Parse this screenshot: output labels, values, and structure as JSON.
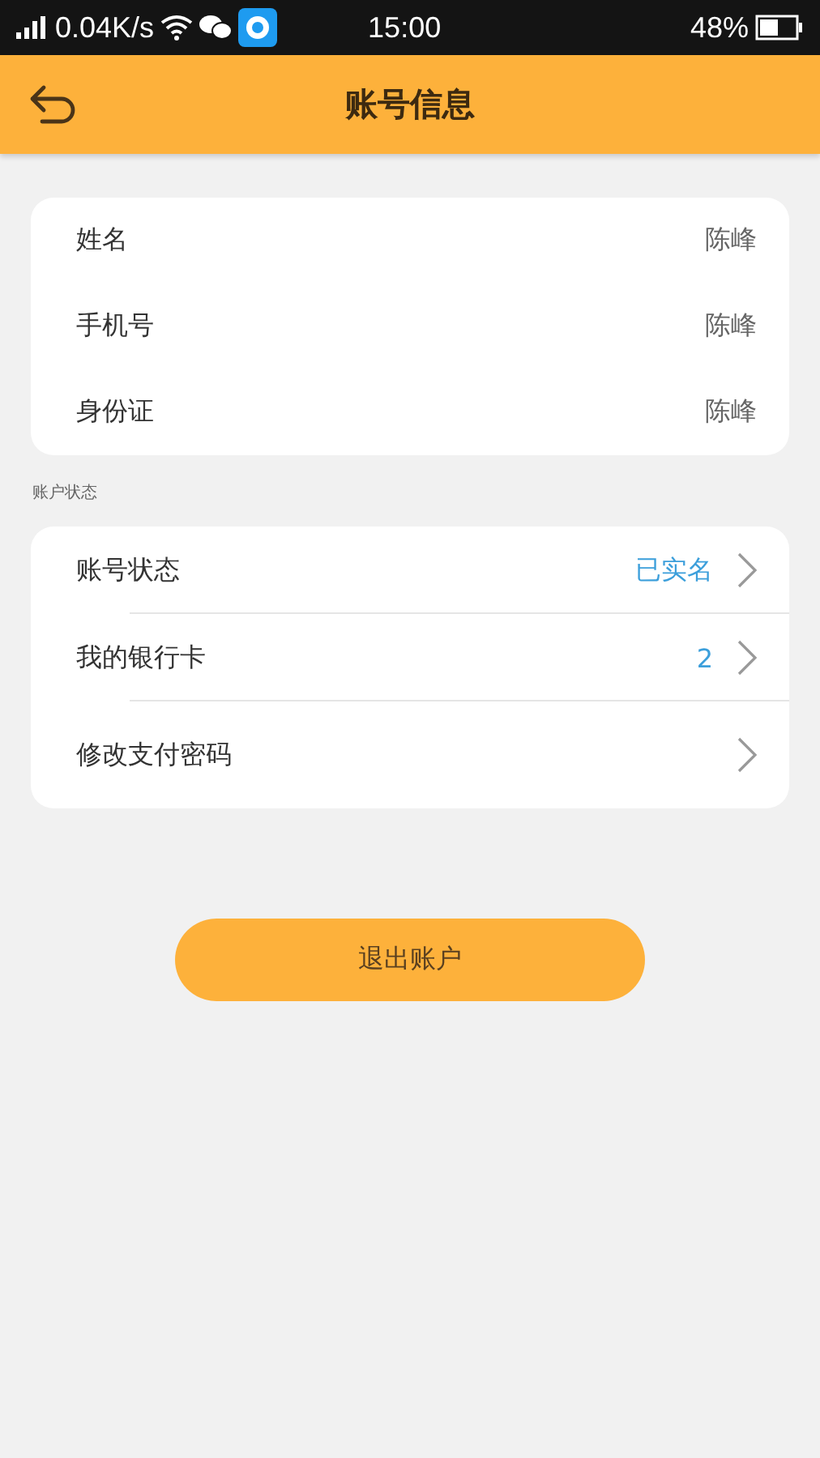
{
  "status_bar": {
    "speed": "0.04K/s",
    "time": "15:00",
    "battery": "48%"
  },
  "header": {
    "title": "账号信息"
  },
  "info_rows": [
    {
      "label": "姓名",
      "value": "陈峰"
    },
    {
      "label": "手机号",
      "value": "陈峰"
    },
    {
      "label": "身份证",
      "value": "陈峰"
    }
  ],
  "section_title": "账户状态",
  "status_rows": [
    {
      "label": "账号状态",
      "value": "已实名"
    },
    {
      "label": "我的银行卡",
      "value": "2"
    },
    {
      "label": "修改支付密码"
    }
  ],
  "logout_button": "退出账户"
}
